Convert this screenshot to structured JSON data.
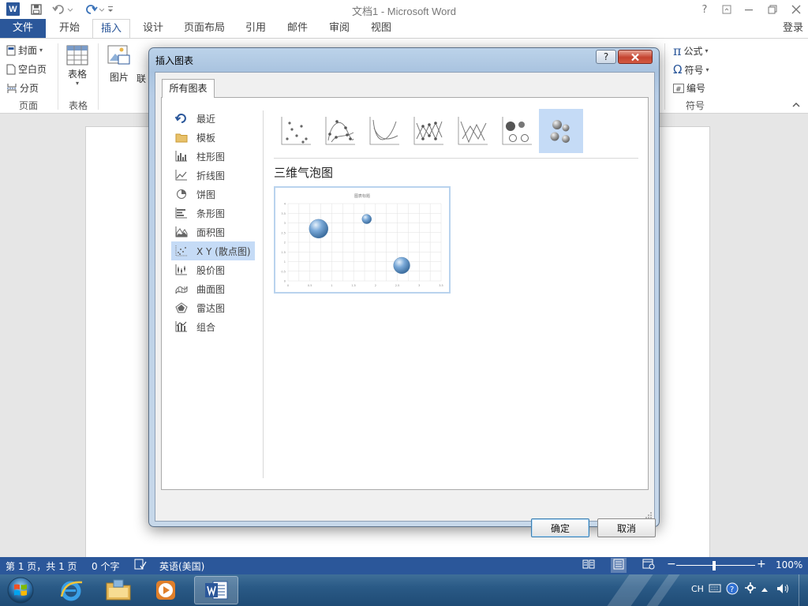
{
  "window": {
    "title": "文档1 - Microsoft Word",
    "help": "?",
    "app_icon_letter": "W"
  },
  "ribbon_tabs": [
    {
      "label": "文件",
      "id": "file"
    },
    {
      "label": "开始",
      "id": "home"
    },
    {
      "label": "插入",
      "id": "insert",
      "active": true
    },
    {
      "label": "设计",
      "id": "design"
    },
    {
      "label": "页面布局",
      "id": "layout"
    },
    {
      "label": "引用",
      "id": "references"
    },
    {
      "label": "邮件",
      "id": "mailings"
    },
    {
      "label": "审阅",
      "id": "review"
    },
    {
      "label": "视图",
      "id": "view"
    }
  ],
  "login": "登录",
  "ribbon": {
    "pages": {
      "cover": "封面",
      "blank_page": "空白页",
      "page_break": "分页",
      "group": "页面"
    },
    "table": {
      "label": "表格",
      "group": "表格"
    },
    "illustrations": {
      "picture": "图片",
      "online": "联"
    },
    "symbols": {
      "equation": "公式",
      "symbol": "符号",
      "number": "编号",
      "group": "符号",
      "pi": "π",
      "omega": "Ω"
    }
  },
  "dialog": {
    "title": "插入图表",
    "help": "?",
    "tab": "所有图表",
    "categories": [
      {
        "label": "最近",
        "icon": "recent-icon"
      },
      {
        "label": "模板",
        "icon": "folder-icon"
      },
      {
        "label": "柱形图",
        "icon": "column-chart-icon"
      },
      {
        "label": "折线图",
        "icon": "line-chart-icon"
      },
      {
        "label": "饼图",
        "icon": "pie-chart-icon"
      },
      {
        "label": "条形图",
        "icon": "bar-chart-icon"
      },
      {
        "label": "面积图",
        "icon": "area-chart-icon"
      },
      {
        "label": "X Y (散点图)",
        "icon": "scatter-chart-icon",
        "selected": true
      },
      {
        "label": "股价图",
        "icon": "stock-chart-icon"
      },
      {
        "label": "曲面图",
        "icon": "surface-chart-icon"
      },
      {
        "label": "雷达图",
        "icon": "radar-chart-icon"
      },
      {
        "label": "组合",
        "icon": "combo-chart-icon"
      }
    ],
    "subtypes": [
      {
        "icon": "scatter-icon"
      },
      {
        "icon": "scatter-smooth-markers-icon"
      },
      {
        "icon": "scatter-smooth-icon"
      },
      {
        "icon": "scatter-straight-markers-icon"
      },
      {
        "icon": "scatter-straight-icon"
      },
      {
        "icon": "bubble-icon"
      },
      {
        "icon": "bubble-3d-icon",
        "selected": true
      }
    ],
    "selected_chart_name": "三维气泡图",
    "preview_title": "图表标题",
    "preview_y_ticks": [
      "0",
      "0.5",
      "1",
      "1.5",
      "2",
      "2.5",
      "3",
      "3.5",
      "4"
    ],
    "preview_x_ticks": [
      "0",
      "0.5",
      "1",
      "1.5",
      "2",
      "2.5",
      "3",
      "3.5"
    ],
    "ok": "确定",
    "cancel": "取消"
  },
  "status": {
    "page": "第 1 页，共 1 页",
    "words": "0 个字",
    "language": "英语(美国)",
    "zoom": "100%",
    "minus": "−",
    "plus": "+"
  },
  "taskbar": {
    "ime": "CH"
  },
  "colors": {
    "word_blue": "#2b579a",
    "selection": "#c5dbf6"
  },
  "chart_data": {
    "type": "scatter",
    "subtype": "bubble-3d",
    "title": "图表标题",
    "xlim": [
      0,
      3.5
    ],
    "ylim": [
      0,
      4
    ],
    "points": [
      {
        "x": 0.7,
        "y": 2.7,
        "size": 3
      },
      {
        "x": 1.8,
        "y": 3.2,
        "size": 1.5
      },
      {
        "x": 2.6,
        "y": 0.8,
        "size": 2.6
      }
    ],
    "grid": true
  }
}
